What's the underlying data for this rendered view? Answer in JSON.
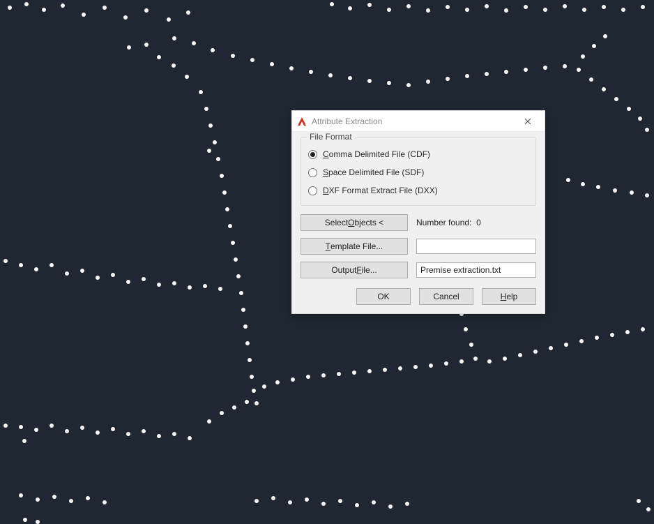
{
  "dialog": {
    "title": "Attribute Extraction",
    "groupbox_legend": "File Format",
    "radios": {
      "cdf": {
        "label_prefix": "C",
        "label_rest": "omma Delimited File (CDF)"
      },
      "sdf": {
        "label_prefix": "S",
        "label_rest": "pace Delimited File (SDF)"
      },
      "dxx": {
        "label_prefix": "D",
        "label_rest": "XF Format Extract File (DXX)"
      }
    },
    "select_objects": {
      "label_pre": "Select ",
      "label_u": "O",
      "label_post": "bjects <"
    },
    "number_found_label": "Number found:",
    "number_found_value": "0",
    "template_file": {
      "label_u": "T",
      "label_post": "emplate File..."
    },
    "template_value": "",
    "output_file": {
      "label_pre": "Output ",
      "label_u": "F",
      "label_post": "ile..."
    },
    "output_value": "Premise extraction.txt",
    "footer": {
      "ok": "OK",
      "cancel": "Cancel",
      "help_u": "H",
      "help_post": "elp"
    }
  }
}
